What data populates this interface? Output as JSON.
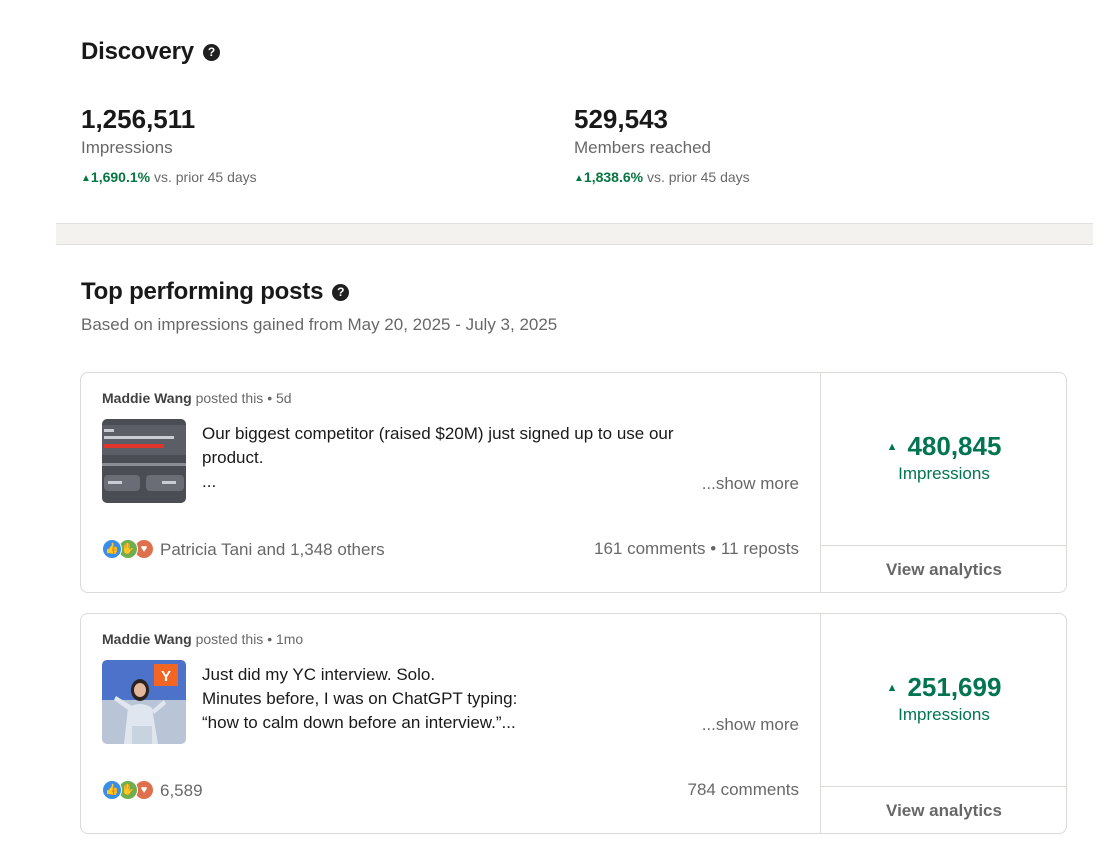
{
  "discovery": {
    "title": "Discovery",
    "stats": [
      {
        "value": "1,256,511",
        "label": "Impressions",
        "change": "1,690.1%",
        "suffix": " vs. prior 45 days"
      },
      {
        "value": "529,543",
        "label": "Members reached",
        "change": "1,838.6%",
        "suffix": " vs. prior 45 days"
      }
    ]
  },
  "top_posts": {
    "title": "Top performing posts",
    "subtitle": "Based on impressions gained from May 20, 2025 - July 3, 2025",
    "show_more": "...show more",
    "view_analytics": "View analytics",
    "impressions_label": "Impressions",
    "posts": [
      {
        "author": "Maddie Wang",
        "meta": " posted this • 5d",
        "lines": [
          "Our biggest competitor (raised $20M) just signed up to use our",
          "product.",
          "..."
        ],
        "reactions_text": "Patricia Tani and 1,348 others",
        "engagement": "161 comments • 11 reposts",
        "impressions": "480,845"
      },
      {
        "author": "Maddie Wang",
        "meta": " posted this • 1mo",
        "lines": [
          "Just did my YC interview. Solo.",
          "Minutes before, I was on ChatGPT typing:",
          "“how to calm down before an interview.”..."
        ],
        "reactions_text": "6,589",
        "engagement": "784 comments",
        "impressions": "251,699"
      }
    ]
  },
  "icons": {
    "help": "question-circle-icon",
    "trend": "triangle-up-icon",
    "reactions": [
      "like-icon",
      "support-icon",
      "love-icon"
    ]
  },
  "colors": {
    "positive": "#057642",
    "impressions": "#01754f"
  }
}
